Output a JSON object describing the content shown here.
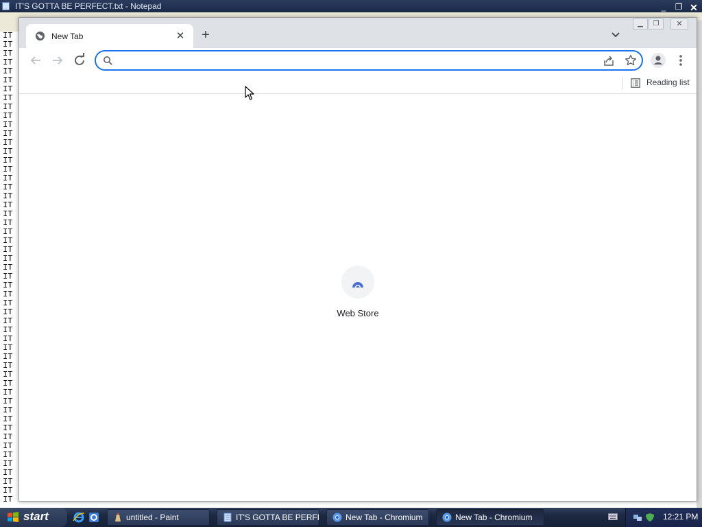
{
  "notepad": {
    "title": "IT'S GOTTA BE PERFECT.txt - Notepad",
    "text_lines": [
      "IT",
      "IT",
      "IT",
      "IT",
      "IT",
      "IT",
      "IT",
      "IT",
      "IT",
      "IT",
      "IT",
      "IT",
      "IT",
      "IT",
      "IT",
      "IT",
      "IT",
      "IT",
      "IT",
      "IT",
      "IT",
      "IT",
      "IT",
      "IT",
      "IT",
      "IT",
      "IT",
      "IT",
      "IT",
      "IT",
      "IT",
      "IT",
      "IT",
      "IT",
      "IT",
      "IT",
      "IT",
      "IT",
      "IT",
      "IT",
      "IT",
      "IT",
      "IT",
      "IT",
      "IT",
      "IT",
      "IT",
      "IT",
      "IT",
      "IT",
      "IT",
      "IT",
      "IT"
    ]
  },
  "browser": {
    "tab": {
      "title": "New Tab",
      "favicon": "globe-icon",
      "close_icon": "close-icon"
    },
    "new_tab_icon": "plus-icon",
    "tab_search_icon": "chevron-down-icon",
    "omnibox": {
      "value": "",
      "placeholder": ""
    },
    "bookmarks_bar": {
      "reading_list_label": "Reading list"
    },
    "shortcuts": [
      {
        "label": "Web Store",
        "icon": "web-store-icon"
      }
    ],
    "accent_color": "#1a73e8"
  },
  "taskbar": {
    "start_label": "start",
    "quick_launch": [
      "internet-explorer-icon",
      "ie-icon"
    ],
    "tasks": [
      {
        "label": "untitled - Paint",
        "icon": "paint-icon",
        "active": false
      },
      {
        "label": "IT'S GOTTA BE PERFE...",
        "icon": "notepad-icon",
        "active": false
      },
      {
        "label": "New Tab - Chromium",
        "icon": "chromium-icon",
        "active": false
      },
      {
        "label": "New Tab - Chromium",
        "icon": "chromium-icon",
        "active": true
      }
    ],
    "clock": "12:21 PM"
  }
}
